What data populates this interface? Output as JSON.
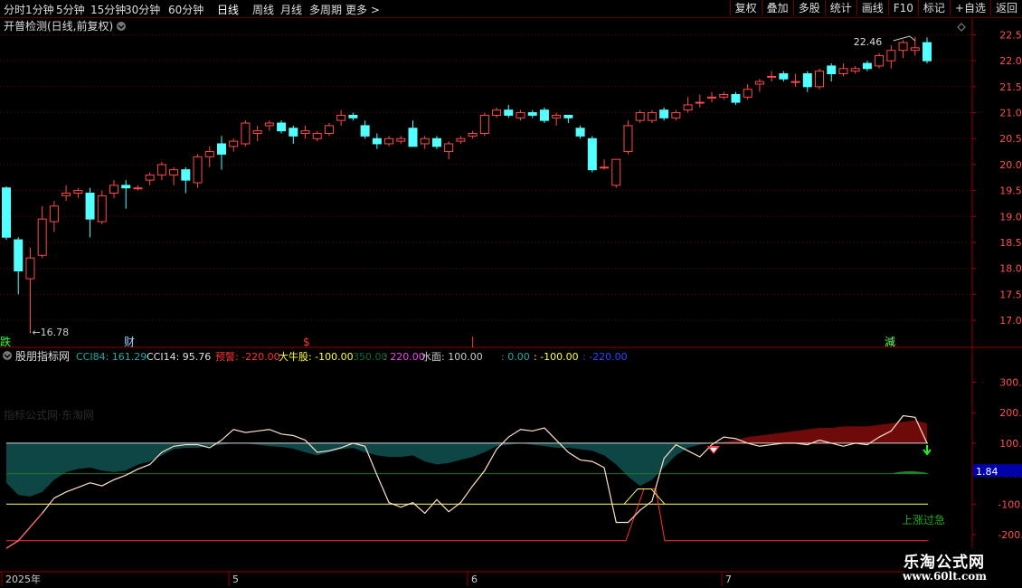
{
  "toolbar": {
    "periods": [
      "分时",
      "1分钟",
      "5分钟",
      "15分钟",
      "30分钟",
      "60分钟",
      "日线",
      "周线",
      "月线",
      "多周期",
      "更多 >"
    ],
    "active_period": "日线",
    "buttons": [
      "复权",
      "叠加",
      "多股",
      "统计",
      "画线",
      "F10",
      "标记",
      "+自选",
      "返回"
    ]
  },
  "main_chart": {
    "title": "开普检测(日线,前复权)",
    "high_label": "22.46",
    "low_label": "16.78",
    "price_axis": [
      "22.50",
      "22.00",
      "21.50",
      "21.00",
      "20.50",
      "20.00",
      "19.50",
      "19.00",
      "18.50",
      "18.00",
      "17.50",
      "17.00"
    ],
    "markers": [
      {
        "text": "跌",
        "color": "#33ff33"
      },
      {
        "text": "财",
        "color": "#9ad0ff"
      },
      {
        "text": "$",
        "color": "#ff3333"
      },
      {
        "text": "減",
        "color": "#66ff66"
      }
    ]
  },
  "indicator": {
    "name": "股朋指标网",
    "legend": [
      {
        "label": "CCI84: 161.29",
        "color": "#2aa6a6"
      },
      {
        "label": "CCI14: 95.76",
        "color": "#e0e0e0"
      },
      {
        "label": "预警: -220.00",
        "color": "#ff3030"
      },
      {
        "label": "大牛股: -100.00",
        "color": "#ffff44"
      },
      {
        "label": "350.00",
        "color": "#0c6b3a"
      },
      {
        "label": ": 220.00",
        "color": "#ee44ee"
      },
      {
        "label": "水面: 100.00",
        "color": "#cccccc"
      },
      {
        "label": ": 0.00",
        "color": "#2aa6a6"
      },
      {
        "label": ": -100.00",
        "color": "#ffff44"
      },
      {
        "label": ": -220.00",
        "color": "#3344ff"
      }
    ],
    "axis": [
      "300.0",
      "200.0",
      "100.0",
      "0.00",
      "-100.0",
      "-200.0"
    ],
    "current_value": "1.84",
    "watermark_text": "指标公式网·东淘网",
    "signal_text": "上涨过急"
  },
  "date_axis": [
    "2025年",
    "5",
    "6",
    "7"
  ],
  "site_watermark": {
    "line1": "乐淘公式网",
    "line2": "www.60lt.com"
  },
  "chart_data": [
    {
      "type": "candlestick",
      "title": "开普检测(日线,前复权)",
      "ylim": [
        16.6,
        22.85
      ],
      "candles": [
        {
          "o": 19.55,
          "h": 19.58,
          "l": 18.55,
          "c": 18.6
        },
        {
          "o": 18.55,
          "h": 18.6,
          "l": 17.5,
          "c": 17.95
        },
        {
          "o": 17.8,
          "h": 18.4,
          "l": 16.78,
          "c": 18.2
        },
        {
          "o": 18.25,
          "h": 19.2,
          "l": 18.2,
          "c": 18.95
        },
        {
          "o": 18.9,
          "h": 19.3,
          "l": 18.7,
          "c": 19.2
        },
        {
          "o": 19.4,
          "h": 19.6,
          "l": 19.3,
          "c": 19.45
        },
        {
          "o": 19.45,
          "h": 19.55,
          "l": 19.35,
          "c": 19.5
        },
        {
          "o": 19.45,
          "h": 19.55,
          "l": 18.6,
          "c": 18.95
        },
        {
          "o": 18.9,
          "h": 19.5,
          "l": 18.85,
          "c": 19.4
        },
        {
          "o": 19.45,
          "h": 19.7,
          "l": 19.35,
          "c": 19.6
        },
        {
          "o": 19.6,
          "h": 19.7,
          "l": 19.15,
          "c": 19.55
        },
        {
          "o": 19.55,
          "h": 19.6,
          "l": 19.5,
          "c": 19.55
        },
        {
          "o": 19.7,
          "h": 19.85,
          "l": 19.6,
          "c": 19.8
        },
        {
          "o": 19.8,
          "h": 20.05,
          "l": 19.7,
          "c": 20.0
        },
        {
          "o": 19.8,
          "h": 19.95,
          "l": 19.6,
          "c": 19.9
        },
        {
          "o": 19.9,
          "h": 19.95,
          "l": 19.45,
          "c": 19.7
        },
        {
          "o": 19.65,
          "h": 20.2,
          "l": 19.55,
          "c": 20.15
        },
        {
          "o": 20.15,
          "h": 20.35,
          "l": 19.95,
          "c": 20.25
        },
        {
          "o": 20.4,
          "h": 20.55,
          "l": 19.9,
          "c": 20.2
        },
        {
          "o": 20.35,
          "h": 20.5,
          "l": 20.25,
          "c": 20.45
        },
        {
          "o": 20.4,
          "h": 20.85,
          "l": 20.35,
          "c": 20.8
        },
        {
          "o": 20.6,
          "h": 20.75,
          "l": 20.45,
          "c": 20.65
        },
        {
          "o": 20.75,
          "h": 20.85,
          "l": 20.65,
          "c": 20.8
        },
        {
          "o": 20.8,
          "h": 20.85,
          "l": 20.6,
          "c": 20.65
        },
        {
          "o": 20.7,
          "h": 20.75,
          "l": 20.4,
          "c": 20.55
        },
        {
          "o": 20.6,
          "h": 20.75,
          "l": 20.5,
          "c": 20.65
        },
        {
          "o": 20.5,
          "h": 20.65,
          "l": 20.45,
          "c": 20.6
        },
        {
          "o": 20.6,
          "h": 20.8,
          "l": 20.55,
          "c": 20.75
        },
        {
          "o": 20.85,
          "h": 21.05,
          "l": 20.75,
          "c": 20.95
        },
        {
          "o": 20.95,
          "h": 21.0,
          "l": 20.85,
          "c": 20.9
        },
        {
          "o": 20.75,
          "h": 20.85,
          "l": 20.5,
          "c": 20.55
        },
        {
          "o": 20.5,
          "h": 20.6,
          "l": 20.3,
          "c": 20.4
        },
        {
          "o": 20.4,
          "h": 20.55,
          "l": 20.35,
          "c": 20.5
        },
        {
          "o": 20.45,
          "h": 20.55,
          "l": 20.4,
          "c": 20.5
        },
        {
          "o": 20.7,
          "h": 20.85,
          "l": 20.35,
          "c": 20.35
        },
        {
          "o": 20.4,
          "h": 20.55,
          "l": 20.3,
          "c": 20.5
        },
        {
          "o": 20.5,
          "h": 20.55,
          "l": 20.3,
          "c": 20.35
        },
        {
          "o": 20.25,
          "h": 20.45,
          "l": 20.1,
          "c": 20.4
        },
        {
          "o": 20.45,
          "h": 20.55,
          "l": 20.4,
          "c": 20.5
        },
        {
          "o": 20.55,
          "h": 20.65,
          "l": 20.5,
          "c": 20.6
        },
        {
          "o": 20.6,
          "h": 21.0,
          "l": 20.55,
          "c": 20.95
        },
        {
          "o": 20.95,
          "h": 21.1,
          "l": 20.9,
          "c": 21.05
        },
        {
          "o": 21.05,
          "h": 21.15,
          "l": 20.9,
          "c": 20.95
        },
        {
          "o": 20.9,
          "h": 21.05,
          "l": 20.85,
          "c": 21.0
        },
        {
          "o": 21.0,
          "h": 21.05,
          "l": 20.9,
          "c": 20.95
        },
        {
          "o": 21.05,
          "h": 21.1,
          "l": 20.8,
          "c": 20.85
        },
        {
          "o": 20.9,
          "h": 21.0,
          "l": 20.75,
          "c": 20.95
        },
        {
          "o": 20.95,
          "h": 20.95,
          "l": 20.8,
          "c": 20.9
        },
        {
          "o": 20.7,
          "h": 20.75,
          "l": 20.5,
          "c": 20.55
        },
        {
          "o": 20.5,
          "h": 20.55,
          "l": 19.85,
          "c": 19.9
        },
        {
          "o": 19.95,
          "h": 20.1,
          "l": 19.9,
          "c": 19.95
        },
        {
          "o": 19.6,
          "h": 20.1,
          "l": 19.55,
          "c": 20.1
        },
        {
          "o": 20.25,
          "h": 20.85,
          "l": 20.2,
          "c": 20.75
        },
        {
          "o": 20.85,
          "h": 21.05,
          "l": 20.8,
          "c": 21.0
        },
        {
          "o": 20.85,
          "h": 21.05,
          "l": 20.8,
          "c": 21.0
        },
        {
          "o": 21.05,
          "h": 21.1,
          "l": 20.85,
          "c": 20.9
        },
        {
          "o": 20.9,
          "h": 21.05,
          "l": 20.85,
          "c": 21.0
        },
        {
          "o": 21.05,
          "h": 21.3,
          "l": 21.0,
          "c": 21.15
        },
        {
          "o": 21.2,
          "h": 21.35,
          "l": 21.1,
          "c": 21.2
        },
        {
          "o": 21.3,
          "h": 21.4,
          "l": 21.2,
          "c": 21.3
        },
        {
          "o": 21.3,
          "h": 21.4,
          "l": 21.25,
          "c": 21.35
        },
        {
          "o": 21.35,
          "h": 21.4,
          "l": 21.15,
          "c": 21.2
        },
        {
          "o": 21.3,
          "h": 21.55,
          "l": 21.25,
          "c": 21.45
        },
        {
          "o": 21.55,
          "h": 21.65,
          "l": 21.4,
          "c": 21.6
        },
        {
          "o": 21.7,
          "h": 21.8,
          "l": 21.6,
          "c": 21.7
        },
        {
          "o": 21.75,
          "h": 21.8,
          "l": 21.6,
          "c": 21.65
        },
        {
          "o": 21.6,
          "h": 21.75,
          "l": 21.5,
          "c": 21.6
        },
        {
          "o": 21.75,
          "h": 21.8,
          "l": 21.4,
          "c": 21.5
        },
        {
          "o": 21.5,
          "h": 21.85,
          "l": 21.45,
          "c": 21.8
        },
        {
          "o": 21.9,
          "h": 21.95,
          "l": 21.6,
          "c": 21.75
        },
        {
          "o": 21.75,
          "h": 21.95,
          "l": 21.7,
          "c": 21.85
        },
        {
          "o": 21.8,
          "h": 21.9,
          "l": 21.75,
          "c": 21.85
        },
        {
          "o": 21.95,
          "h": 22.0,
          "l": 21.8,
          "c": 21.85
        },
        {
          "o": 21.9,
          "h": 22.15,
          "l": 21.85,
          "c": 22.1
        },
        {
          "o": 22.0,
          "h": 22.3,
          "l": 21.85,
          "c": 22.2
        },
        {
          "o": 22.2,
          "h": 22.4,
          "l": 22.05,
          "c": 22.35
        },
        {
          "o": 22.2,
          "h": 22.46,
          "l": 22.1,
          "c": 22.25
        },
        {
          "o": 22.35,
          "h": 22.45,
          "l": 21.95,
          "c": 22.0
        }
      ]
    },
    {
      "type": "line",
      "title": "股朋指标网",
      "ylim": [
        -250,
        380
      ],
      "series": [
        {
          "name": "CCI84",
          "values": [
            -30,
            -70,
            -75,
            -60,
            -20,
            5,
            15,
            20,
            10,
            5,
            10,
            30,
            40,
            60,
            80,
            85,
            85,
            90,
            95,
            100,
            100,
            95,
            90,
            88,
            82,
            70,
            60,
            70,
            80,
            85,
            70,
            60,
            55,
            55,
            60,
            40,
            30,
            35,
            45,
            55,
            70,
            90,
            95,
            100,
            95,
            90,
            85,
            85,
            80,
            75,
            60,
            30,
            -10,
            -40,
            -20,
            20,
            60,
            85,
            95,
            100,
            105,
            110,
            120,
            125,
            130,
            135,
            140,
            145,
            150,
            150,
            155,
            155,
            155,
            160,
            165,
            170,
            175,
            165
          ]
        },
        {
          "name": "CCI14",
          "values": [
            -245,
            -220,
            -175,
            -130,
            -80,
            -60,
            -45,
            -30,
            -40,
            -20,
            -5,
            15,
            30,
            70,
            90,
            95,
            95,
            85,
            110,
            145,
            135,
            140,
            145,
            130,
            125,
            110,
            70,
            75,
            85,
            100,
            90,
            -5,
            -95,
            -110,
            -95,
            -130,
            -85,
            -125,
            -95,
            -40,
            10,
            80,
            120,
            145,
            140,
            150,
            110,
            70,
            45,
            40,
            20,
            -160,
            -160,
            -120,
            -90,
            50,
            95,
            75,
            55,
            95,
            120,
            115,
            100,
            90,
            95,
            100,
            100,
            95,
            110,
            100,
            90,
            100,
            95,
            120,
            140,
            190,
            185,
            100
          ]
        }
      ]
    }
  ]
}
